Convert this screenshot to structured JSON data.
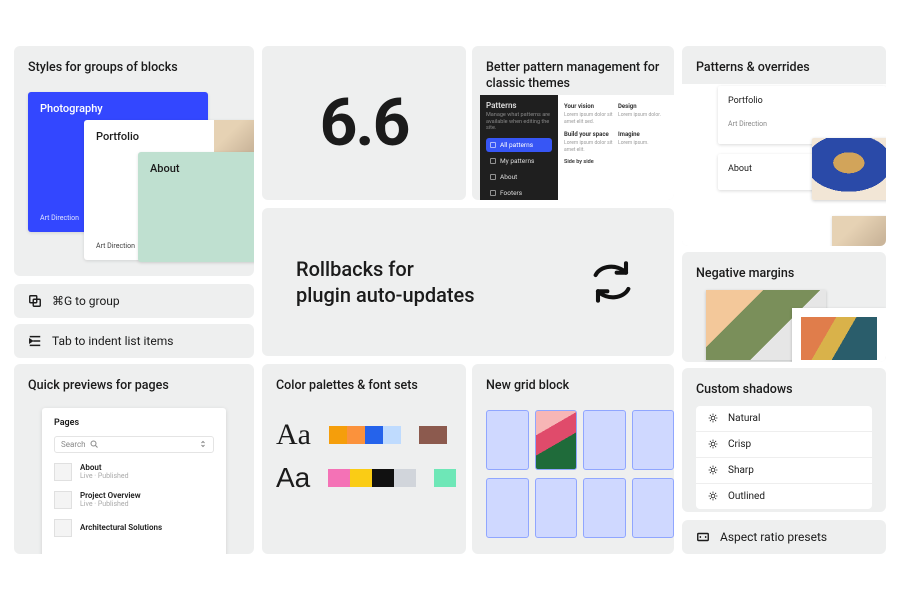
{
  "styles": {
    "title": "Styles for groups of blocks",
    "cards": {
      "photo": {
        "title": "Photography",
        "sub": "Art Direction"
      },
      "portfolio": {
        "title": "Portfolio",
        "sub": "Art Direction"
      },
      "about": {
        "title": "About"
      }
    }
  },
  "chips": {
    "group": "⌘G to group",
    "tab": "Tab to indent list items",
    "aspect": "Aspect ratio presets"
  },
  "quick": {
    "title": "Quick previews for pages",
    "panel_title": "Pages",
    "search_placeholder": "Search",
    "items": [
      {
        "name": "About",
        "meta": "Live · Published"
      },
      {
        "name": "Project Overview",
        "meta": "Live · Published"
      },
      {
        "name": "Architectural Solutions",
        "meta": ""
      }
    ]
  },
  "version": "6.6",
  "pattern": {
    "title": "Better pattern management for classic themes",
    "sidebar_title": "Patterns",
    "sidebar_desc": "Manage what patterns are available when editing the site.",
    "items": [
      {
        "label": "All patterns",
        "selected": true
      },
      {
        "label": "My patterns",
        "selected": false
      },
      {
        "label": "About",
        "selected": false
      },
      {
        "label": "Footers",
        "selected": false
      }
    ],
    "doc": {
      "a_title": "Your vision",
      "a_sub": "Design",
      "b_title": "Build your space",
      "b_sub": "Imagine",
      "footer": "Side by side"
    }
  },
  "rollbacks": {
    "text": "Rollbacks for plugin auto-updates"
  },
  "colors": {
    "title": "Color palettes & font sets",
    "sample": "Aa",
    "palette1": [
      "#f59e0b",
      "#fb923c",
      "#2563eb",
      "#bfdbfe"
    ],
    "palette1b": [
      "#8c5a4e"
    ],
    "palette2": [
      "#f472b6",
      "#facc15",
      "#111111",
      "#d1d5db"
    ],
    "palette2b": [
      "#6ee7b7"
    ]
  },
  "grid": {
    "title": "New grid block"
  },
  "overrides": {
    "title": "Patterns & overrides",
    "cards": [
      {
        "title": "Portfolio",
        "sub": "Art Direction"
      },
      {
        "title": "About",
        "sub": ""
      }
    ]
  },
  "neg": {
    "title": "Negative margins"
  },
  "shadows": {
    "title": "Custom shadows",
    "items": [
      "Natural",
      "Crisp",
      "Sharp",
      "Outlined"
    ]
  }
}
